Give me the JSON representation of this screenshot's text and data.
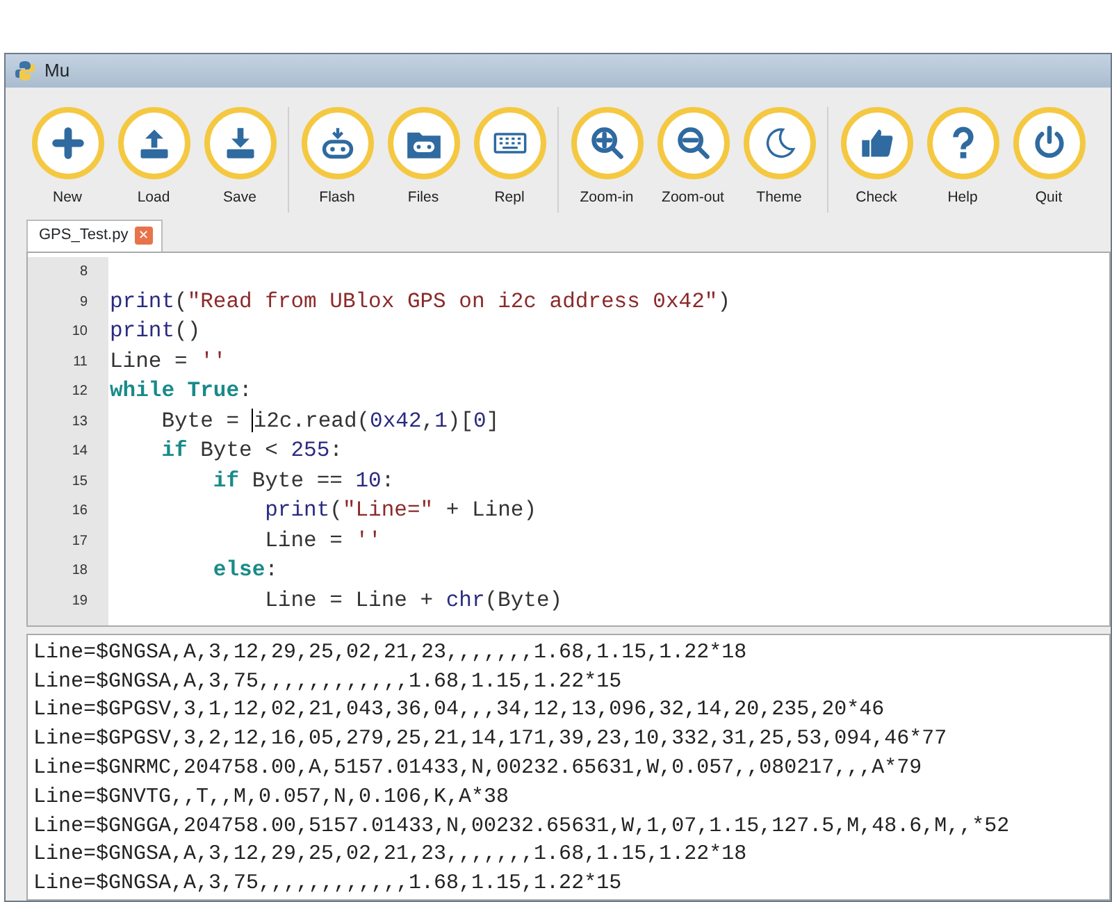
{
  "window": {
    "title": "Mu"
  },
  "toolbar": [
    [
      "New",
      "Load",
      "Save"
    ],
    [
      "Flash",
      "Files",
      "Repl"
    ],
    [
      "Zoom-in",
      "Zoom-out",
      "Theme"
    ],
    [
      "Check",
      "Help",
      "Quit"
    ]
  ],
  "tabs": [
    {
      "label": "GPS_Test.py",
      "close": "✕",
      "selected": true
    }
  ],
  "editor": {
    "lines": [
      {
        "number": "8"
      },
      {
        "number": "9",
        "segments": [
          {
            "kind": "builtin",
            "text": "print"
          },
          {
            "kind": "plain",
            "text": "("
          },
          {
            "kind": "string",
            "text": "\"Read from UBlox GPS on i2c address 0x42\""
          },
          {
            "kind": "plain",
            "text": ")"
          }
        ]
      },
      {
        "number": "10",
        "segments": [
          {
            "kind": "builtin",
            "text": "print"
          },
          {
            "kind": "plain",
            "text": "()"
          }
        ]
      },
      {
        "number": "11",
        "segments": [
          {
            "kind": "plain",
            "text": "Line = "
          },
          {
            "kind": "string",
            "text": "''"
          }
        ]
      },
      {
        "number": "12",
        "segments": [
          {
            "kind": "keyword",
            "text": "while True"
          },
          {
            "kind": "plain",
            "text": ":"
          }
        ]
      },
      {
        "number": "13",
        "segments": [
          {
            "kind": "plain",
            "text": "    Byte = "
          },
          {
            "kind": "plain",
            "text": "i2c.read(",
            "cursor_before": true
          },
          {
            "kind": "number",
            "text": "0x42"
          },
          {
            "kind": "plain",
            "text": ","
          },
          {
            "kind": "number",
            "text": "1"
          },
          {
            "kind": "plain",
            "text": ")["
          },
          {
            "kind": "number",
            "text": "0"
          },
          {
            "kind": "plain",
            "text": "]"
          }
        ]
      },
      {
        "number": "14",
        "segments": [
          {
            "kind": "keyword",
            "text": "    if"
          },
          {
            "kind": "plain",
            "text": " Byte < "
          },
          {
            "kind": "number",
            "text": "255"
          },
          {
            "kind": "plain",
            "text": ":"
          }
        ]
      },
      {
        "number": "15",
        "segments": [
          {
            "kind": "keyword",
            "text": "        if"
          },
          {
            "kind": "plain",
            "text": " Byte == "
          },
          {
            "kind": "number",
            "text": "10"
          },
          {
            "kind": "plain",
            "text": ":"
          }
        ]
      },
      {
        "number": "16",
        "segments": [
          {
            "kind": "builtin",
            "text": "            print"
          },
          {
            "kind": "plain",
            "text": "("
          },
          {
            "kind": "string",
            "text": "\"Line=\""
          },
          {
            "kind": "plain",
            "text": " + Line)"
          }
        ]
      },
      {
        "number": "17",
        "segments": [
          {
            "kind": "plain",
            "text": "            Line = "
          },
          {
            "kind": "string",
            "text": "''"
          }
        ]
      },
      {
        "number": "18",
        "segments": [
          {
            "kind": "keyword",
            "text": "        else"
          },
          {
            "kind": "plain",
            "text": ":"
          }
        ]
      },
      {
        "number": "19",
        "segments": [
          {
            "kind": "plain",
            "text": "            Line = Line + "
          },
          {
            "kind": "builtin",
            "text": "chr"
          },
          {
            "kind": "plain",
            "text": "(Byte)"
          }
        ]
      }
    ]
  },
  "repl": {
    "lines": [
      "Line=$GNGSA,A,3,12,29,25,02,21,23,,,,,,,1.68,1.15,1.22*18",
      "Line=$GNGSA,A,3,75,,,,,,,,,,,,1.68,1.15,1.22*15",
      "Line=$GPGSV,3,1,12,02,21,043,36,04,,,34,12,13,096,32,14,20,235,20*46",
      "Line=$GPGSV,3,2,12,16,05,279,25,21,14,171,39,23,10,332,31,25,53,094,46*77",
      "Line=$GNRMC,204758.00,A,5157.01433,N,00232.65631,W,0.057,,080217,,,A*79",
      "Line=$GNVTG,,T,,M,0.057,N,0.106,K,A*38",
      "Line=$GNGGA,204758.00,5157.01433,N,00232.65631,W,1,07,1.15,127.5,M,48.6,M,,*52",
      "Line=$GNGSA,A,3,12,29,25,02,21,23,,,,,,,1.68,1.15,1.22*18",
      "Line=$GNGSA,A,3,75,,,,,,,,,,,,1.68,1.15,1.22*15"
    ]
  }
}
